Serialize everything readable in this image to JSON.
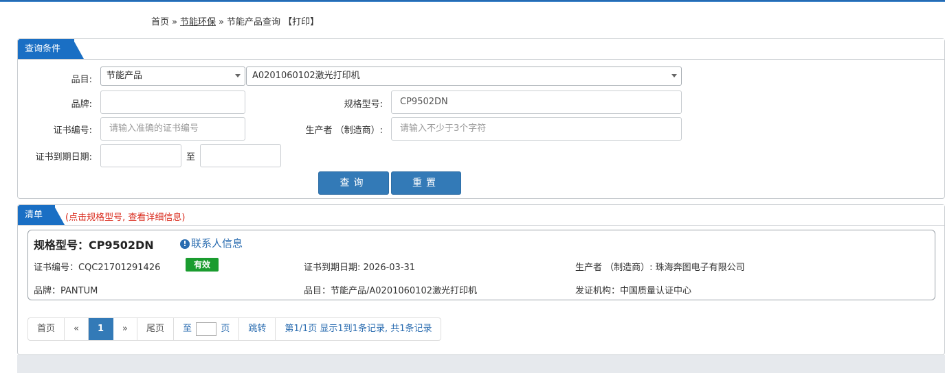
{
  "breadcrumb": {
    "home": "首页",
    "sep1": "»",
    "category": "节能环保",
    "sep2": "»",
    "page": "节能产品查询",
    "print": "【打印】"
  },
  "query_panel": {
    "tab": "查询条件",
    "category_label": "品目:",
    "category_select": "节能产品",
    "sub_category_select": "A0201060102激光打印机",
    "brand_label": "品牌:",
    "brand_value": "",
    "model_label": "规格型号:",
    "model_value": "CP9502DN",
    "cert_no_label": "证书编号:",
    "cert_no_placeholder": "请输入准确的证书编号",
    "maker_label": "生产者 （制造商）:",
    "maker_placeholder": "请输入不少于3个字符",
    "expiry_label": "证书到期日期:",
    "expiry_to": "至",
    "search_button": "查询",
    "reset_button": "重置"
  },
  "list_panel": {
    "tab": "清单",
    "note": "(点击规格型号, 查看详细信息)",
    "items": [
      {
        "title": "规格型号：CP9502DN",
        "contact": "联系人信息",
        "contact_icon": "info-icon",
        "cert_no": "证书编号：CQC21701291426",
        "status": "有效",
        "status_color": "#1a9c2f",
        "expiry": "证书到期日期: 2026-03-31",
        "maker": "生产者 （制造商）: 珠海奔图电子有限公司",
        "brand": "品牌：PANTUM",
        "category": "品目：节能产品/A0201060102激光打印机",
        "issuer": "发证机构：中国质量认证中心"
      }
    ]
  },
  "pager": {
    "first": "首页",
    "prev": "«",
    "current": "1",
    "next": "»",
    "last": "尾页",
    "goto_prefix": "至",
    "goto_suffix": "页",
    "jump": "跳转",
    "summary": "第1/1页  显示1到1条记录, 共1条记录"
  },
  "colors": {
    "accent": "#1a6fc4",
    "button": "#337ab7",
    "note": "#d9281a",
    "valid": "#1a9c2f"
  }
}
